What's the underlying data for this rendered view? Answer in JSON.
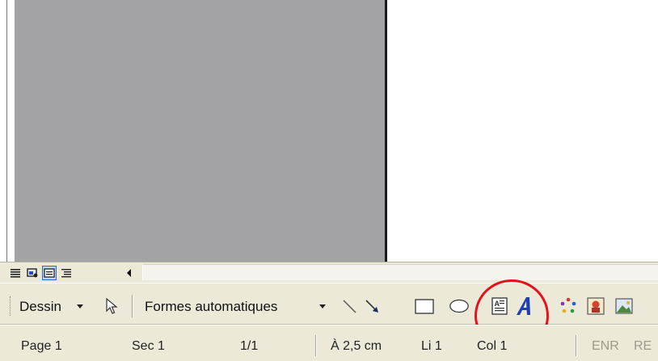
{
  "view_bar": {
    "buttons": [
      {
        "name": "normal-view"
      },
      {
        "name": "web-layout-view"
      },
      {
        "name": "print-layout-view"
      },
      {
        "name": "outline-view"
      }
    ]
  },
  "drawing_toolbar": {
    "draw_menu_label": "Dessin",
    "autoshapes_label": "Formes automatiques",
    "icons": [
      "select-objects-icon",
      "line-icon",
      "arrow-icon",
      "rectangle-icon",
      "oval-icon",
      "text-box-icon",
      "wordart-icon",
      "diagram-icon",
      "clip-art-icon",
      "insert-picture-icon"
    ]
  },
  "status_bar": {
    "page": "Page 1",
    "section": "Sec 1",
    "page_count": "1/1",
    "position": "À 2,5 cm",
    "line": "Li 1",
    "column": "Col 1",
    "record": "ENR",
    "revisions": "RE"
  },
  "colors": {
    "gray_page": "#a3a3a6",
    "toolbar_bg": "#ece9d8",
    "highlight_circle": "#e1141b",
    "wordart_blue": "#1f3fb0"
  }
}
